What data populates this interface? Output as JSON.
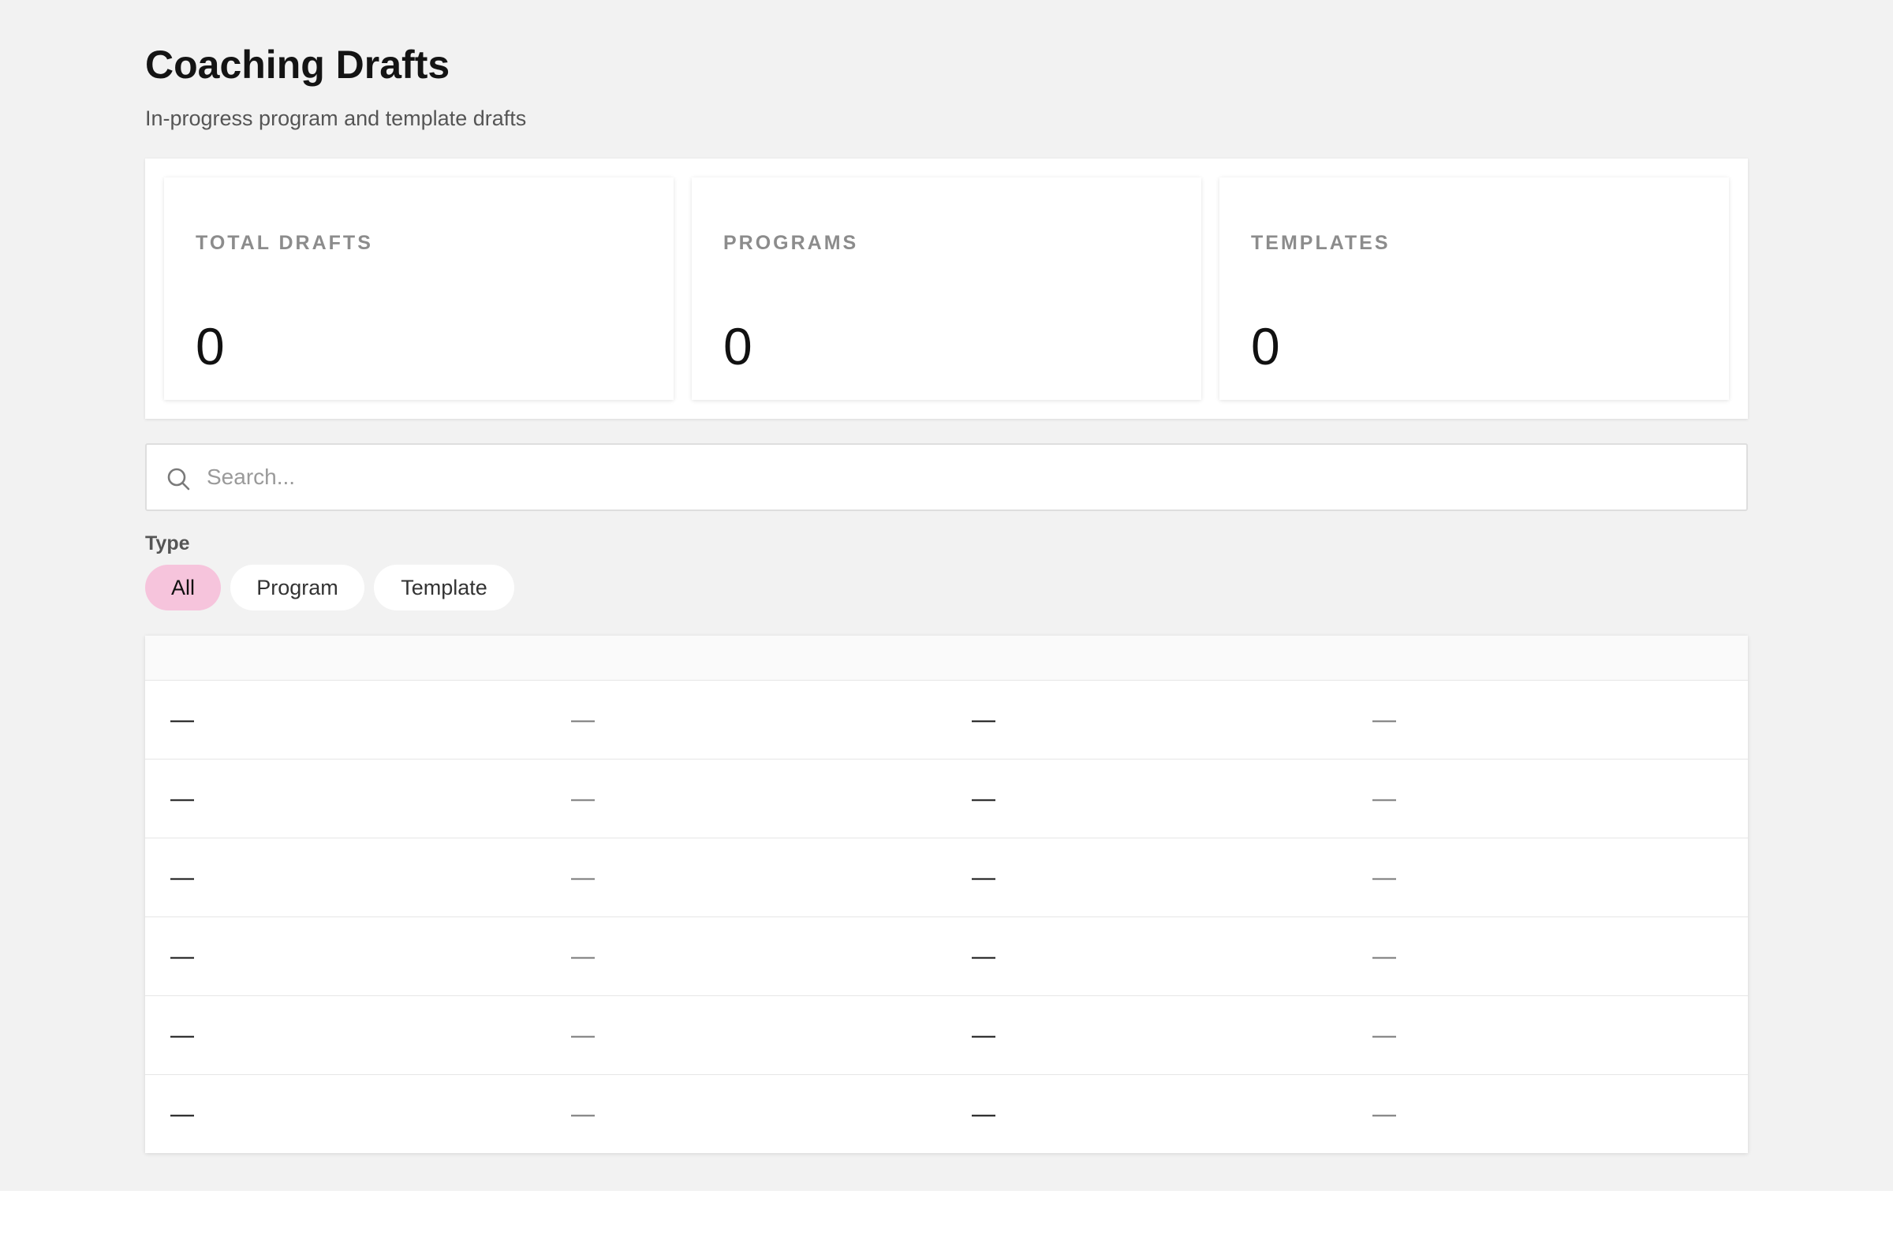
{
  "header": {
    "title": "Coaching Drafts",
    "subtitle": "In-progress program and template drafts"
  },
  "stats": [
    {
      "label": "TOTAL DRAFTS",
      "value": "0"
    },
    {
      "label": "PROGRAMS",
      "value": "0"
    },
    {
      "label": "TEMPLATES",
      "value": "0"
    }
  ],
  "search": {
    "placeholder": "Search...",
    "value": "",
    "icon": "search-icon"
  },
  "filter": {
    "label": "Type",
    "selected": "All",
    "options": [
      "All",
      "Program",
      "Template"
    ]
  },
  "table": {
    "rows": [
      [
        "—",
        "—",
        "—",
        "—"
      ],
      [
        "—",
        "—",
        "—",
        "—"
      ],
      [
        "—",
        "—",
        "—",
        "—"
      ],
      [
        "—",
        "—",
        "—",
        "—"
      ],
      [
        "—",
        "—",
        "—",
        "—"
      ],
      [
        "—",
        "—",
        "—",
        "—"
      ]
    ]
  },
  "colors": {
    "page_background": "#f2f2f2",
    "active_chip": "#f6c4dc",
    "card_background": "#ffffff"
  }
}
